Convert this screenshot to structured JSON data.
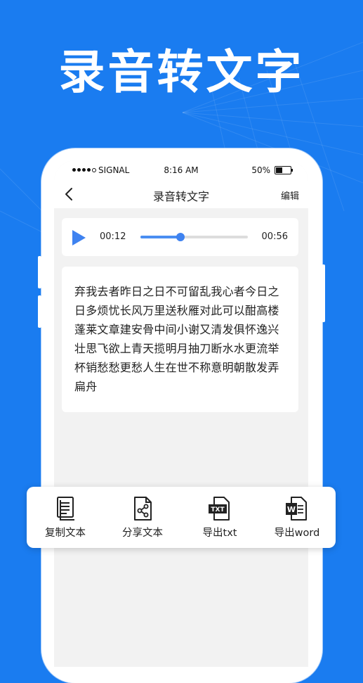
{
  "promo": {
    "headline": "录音转文字"
  },
  "status_bar": {
    "signal": "SIGNAL",
    "time": "8:16 AM",
    "battery": "50%",
    "battery_level": 0.5
  },
  "nav": {
    "title": "录音转文字",
    "edit_label": "编辑"
  },
  "player": {
    "current_time": "00:12",
    "total_time": "00:56",
    "progress": 0.37,
    "accent": "#3e82f0"
  },
  "transcript": {
    "text": "弃我去者昨日之日不可留乱我心者今日之日多烦忧长风万里送秋雁对此可以酣高楼蓬莱文章建安骨中间小谢又清发俱怀逸兴壮思飞欲上青天揽明月抽刀断水水更流举杯销愁愁更愁人生在世不称意明朝散发弄扁舟"
  },
  "toolbar": {
    "items": [
      {
        "label": "复制文本",
        "icon": "copy-document-icon"
      },
      {
        "label": "分享文本",
        "icon": "share-document-icon"
      },
      {
        "label": "导出txt",
        "icon": "txt-file-icon",
        "badge": "TXT"
      },
      {
        "label": "导出word",
        "icon": "word-file-icon",
        "badge": "W"
      }
    ]
  },
  "colors": {
    "background": "#1a7cf0",
    "screen_bg": "#f2f2f2"
  }
}
